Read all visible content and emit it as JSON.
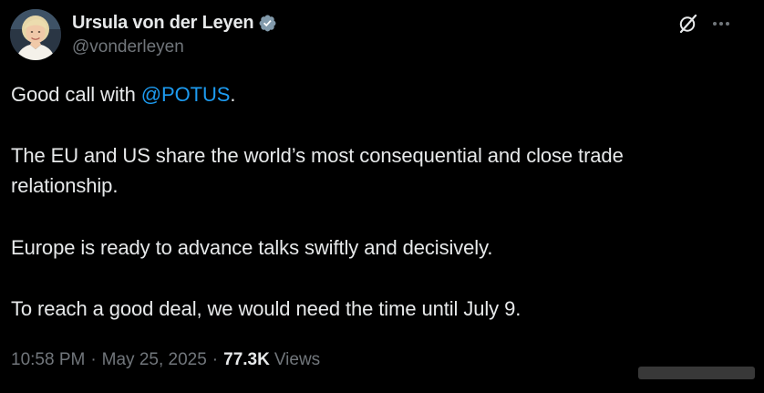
{
  "author": {
    "display_name": "Ursula von der Leyen",
    "handle": "@vonderleyen",
    "verified": true,
    "avatar_icon": "profile-photo",
    "verified_icon": "verified-badge-icon"
  },
  "header_actions": {
    "grok_icon": "grok-icon",
    "more_icon": "more-options-icon"
  },
  "tweet": {
    "line1_prefix": "Good call with ",
    "line1_mention": "@POTUS",
    "line1_suffix": ".",
    "para2_line1": "The EU and US share the world’s most consequential and close trade",
    "para2_line2": "relationship.",
    "para3": "Europe is ready to advance talks swiftly and decisively.",
    "para4": "To reach a good deal, we would need the time until July 9."
  },
  "meta": {
    "time": "10:58 PM",
    "separator": "·",
    "date": "May 25, 2025",
    "views_count": "77.3K",
    "views_label": "Views"
  },
  "colors": {
    "background": "#000000",
    "text_primary": "#e7e9ea",
    "text_secondary": "#71767b",
    "accent_blue": "#1d9bf0"
  }
}
